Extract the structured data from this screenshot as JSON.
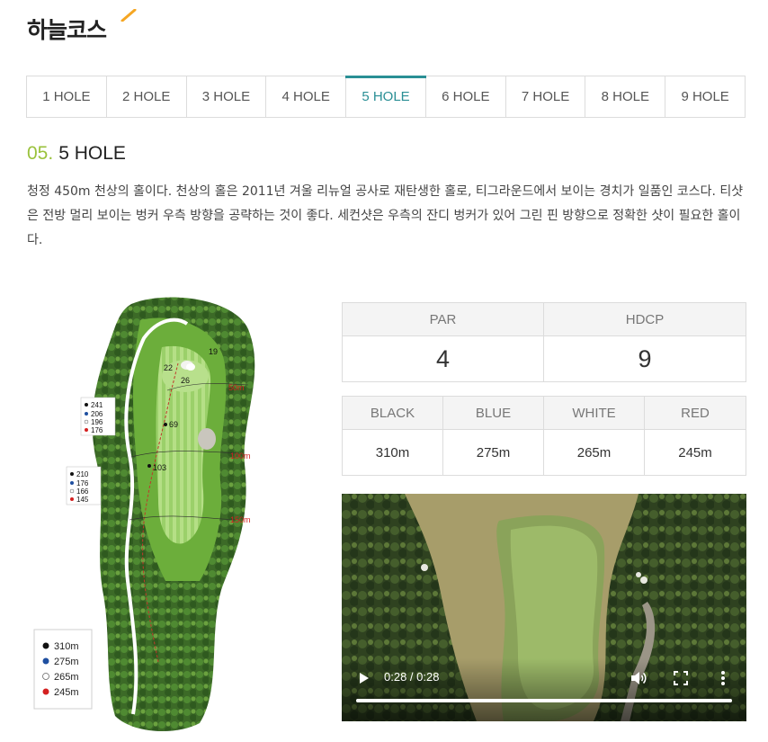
{
  "course": {
    "title": "하늘코스",
    "accent_color": "#f5a623"
  },
  "tabs": [
    {
      "label": "1 HOLE",
      "active": false
    },
    {
      "label": "2 HOLE",
      "active": false
    },
    {
      "label": "3 HOLE",
      "active": false
    },
    {
      "label": "4 HOLE",
      "active": false
    },
    {
      "label": "5 HOLE",
      "active": true
    },
    {
      "label": "6 HOLE",
      "active": false
    },
    {
      "label": "7 HOLE",
      "active": false
    },
    {
      "label": "8 HOLE",
      "active": false
    },
    {
      "label": "9 HOLE",
      "active": false
    }
  ],
  "hole": {
    "number": "05.",
    "name": "5 HOLE",
    "description": "청정 450m 천상의 홀이다. 천상의 홀은 2011년 겨울 리뉴얼 공사로 재탄생한 홀로, 티그라운드에서 보이는 경치가 일품인 코스다. 티샷은 전방 멀리 보이는 벙커 우측 방향을 공략하는 것이 좋다. 세컨샷은 우측의 잔디 벙커가 있어 그린 핀 방향으로 정확한 샷이 필요한 홀이다."
  },
  "map": {
    "labels": {
      "green_marks": [
        "19",
        "22",
        "26"
      ],
      "fairway_marks": [
        "69",
        "103"
      ],
      "distance_marks": [
        "50m",
        "100m",
        "150m"
      ],
      "yardage_box_1": [
        "241",
        "206",
        "196",
        "176"
      ],
      "yardage_box_2": [
        "210",
        "176",
        "166",
        "145"
      ]
    },
    "legend": [
      {
        "label": "310m",
        "color": "#111111"
      },
      {
        "label": "275m",
        "color": "#1f4fa0"
      },
      {
        "label": "265m",
        "color": "#ffffff"
      },
      {
        "label": "245m",
        "color": "#d42020"
      }
    ]
  },
  "scorecard": {
    "par_label": "PAR",
    "par_value": "4",
    "hdcp_label": "HDCP",
    "hdcp_value": "9",
    "tees": [
      {
        "label": "BLACK",
        "value": "310m"
      },
      {
        "label": "BLUE",
        "value": "275m"
      },
      {
        "label": "WHITE",
        "value": "265m"
      },
      {
        "label": "RED",
        "value": "245m"
      }
    ]
  },
  "video": {
    "time": "0:28 / 0:28",
    "progress": 1.0
  },
  "theme": {
    "tab_active": "#2a8f95",
    "hole_number": "#9ac23c"
  }
}
